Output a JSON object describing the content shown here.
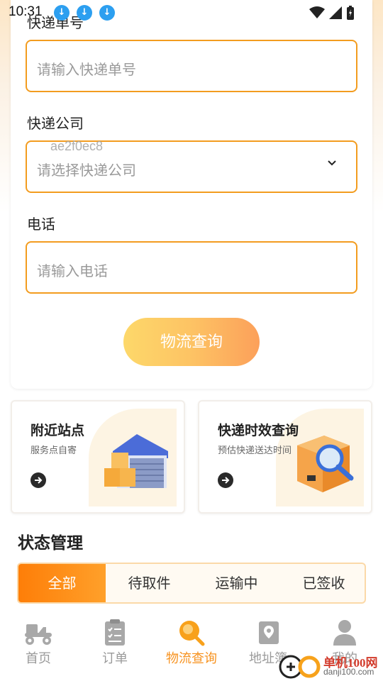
{
  "status_bar": {
    "time": "10:31",
    "download_icon_glyph": "↓"
  },
  "form": {
    "tracking_number": {
      "label": "快递单号",
      "placeholder": "请输入快递单号"
    },
    "courier_company": {
      "label": "快递公司",
      "placeholder": "请选择快递公司"
    },
    "phone": {
      "label": "电话",
      "placeholder": "请输入电话"
    },
    "watermark": "ae2f0ec8",
    "submit_label": "物流查询"
  },
  "features": [
    {
      "title": "附近站点",
      "subtitle": "服务点自寄",
      "icon": "warehouse-icon"
    },
    {
      "title": "快递时效查询",
      "subtitle": "预估快递送达时间",
      "icon": "package-search-icon"
    }
  ],
  "status_management": {
    "title": "状态管理",
    "tabs": [
      "全部",
      "待取件",
      "运输中",
      "已签收"
    ],
    "active_tab": "全部"
  },
  "bottom_nav": {
    "items": [
      {
        "label": "首页",
        "icon": "scooter-icon"
      },
      {
        "label": "订单",
        "icon": "clipboard-icon"
      },
      {
        "label": "物流查询",
        "icon": "search-icon"
      },
      {
        "label": "地址簿",
        "icon": "map-pin-icon"
      },
      {
        "label": "我的",
        "icon": "user-icon"
      }
    ],
    "active": "物流查询"
  },
  "watermark_logo": {
    "cn": "单机100网",
    "en": "danji100.com"
  },
  "colors": {
    "accent": "#f39c1f",
    "active_tab": "#fe7e08",
    "nav_active": "#f7921e"
  }
}
